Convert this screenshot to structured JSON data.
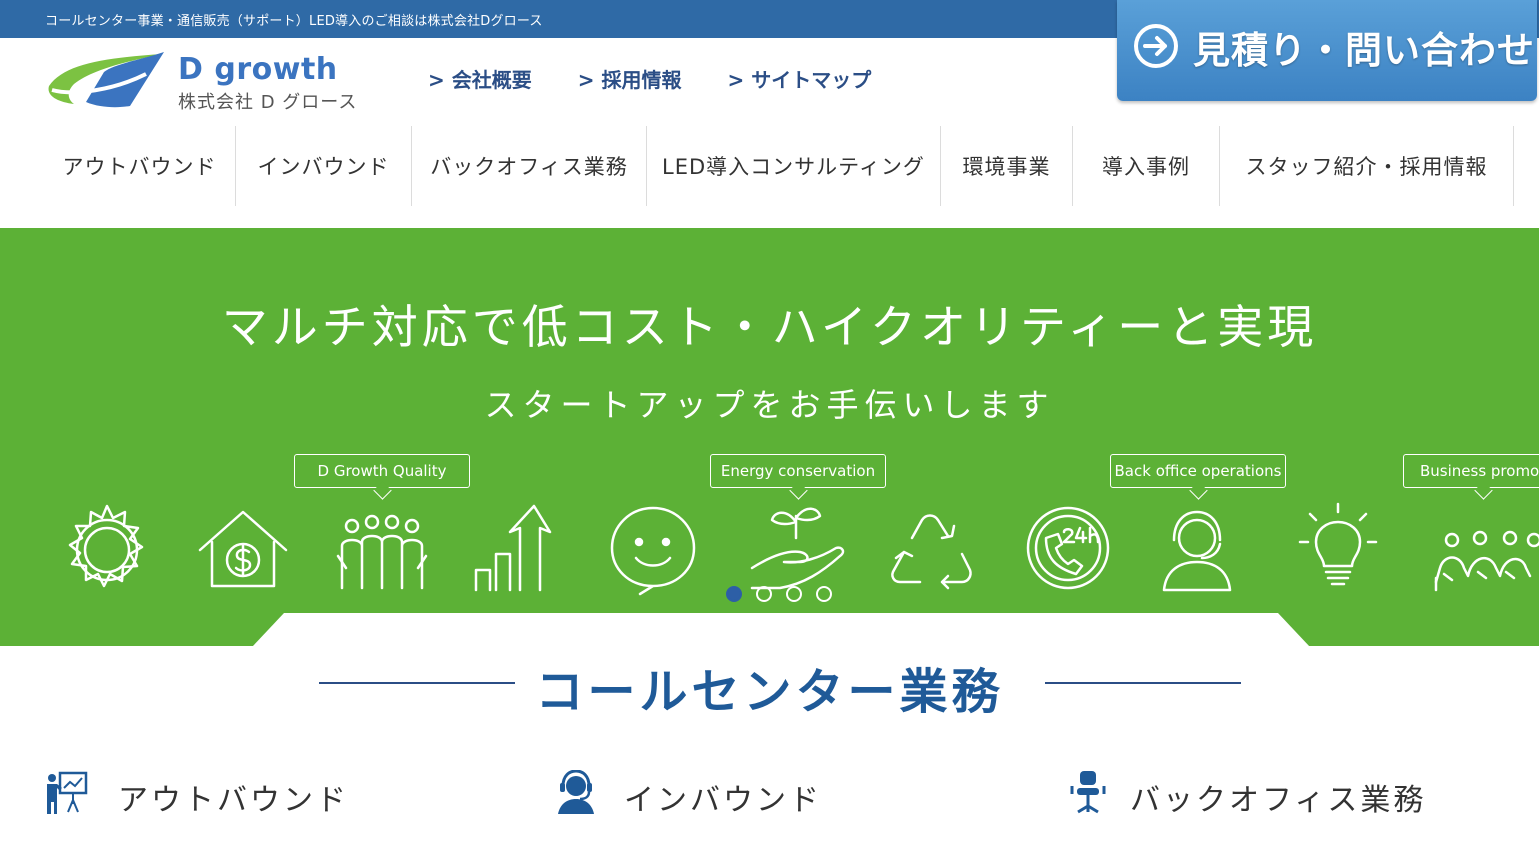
{
  "topbar": {
    "text": "コールセンター事業・通信販売（サポート）LED導入のご相談は株式会社Dグロース"
  },
  "cta": {
    "label": "見積り・問い合わせ",
    "icon": "arrow-circle-right-icon"
  },
  "logo": {
    "name": "D growth",
    "sub": "株式会社 D グロース"
  },
  "toplinks": [
    {
      "label": "> 会社概要"
    },
    {
      "label": "> 採用情報"
    },
    {
      "label": "> サイトマップ"
    }
  ],
  "gnav": [
    {
      "label": "アウトバウンド"
    },
    {
      "label": "インバウンド"
    },
    {
      "label": "バックオフィス業務"
    },
    {
      "label": "LED導入コンサルティング"
    },
    {
      "label": "環境事業"
    },
    {
      "label": "導入事例"
    },
    {
      "label": "スタッフ紹介・採用情報"
    }
  ],
  "hero": {
    "title": "マルチ対応で低コスト・ハイクオリティーと実現",
    "subtitle": "スタートアップをお手伝いします",
    "callouts": [
      "D Growth Quality",
      "Energy conservation",
      "Back office operations",
      "Business promot"
    ],
    "icons": [
      "sun-icon",
      "house-money-icon",
      "crowd-icon",
      "growth-chart-icon",
      "smiley-chat-icon",
      "plant-in-hand-icon",
      "recycle-icon",
      "24h-phone-icon",
      "operator-headset-icon",
      "lightbulb-icon",
      "team-icon"
    ],
    "slides": 4,
    "active_slide": 1
  },
  "section": {
    "title": "コールセンター業務"
  },
  "services": [
    {
      "label": "アウトバウンド",
      "icon": "presentation-icon"
    },
    {
      "label": "インバウンド",
      "icon": "operator-icon"
    },
    {
      "label": "バックオフィス業務",
      "icon": "office-chair-icon"
    }
  ],
  "colors": {
    "topbar": "#2f6aa6",
    "hero_green": "#5cb136",
    "brand_blue": "#1f5a98",
    "cta_blue": "#4a90cf"
  }
}
